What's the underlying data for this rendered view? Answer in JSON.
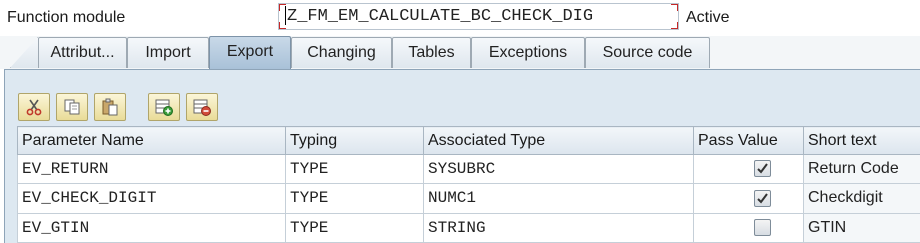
{
  "header": {
    "label": "Function module",
    "value": "Z_FM_EM_CALCULATE_BC_CHECK_DIG",
    "status": "Active"
  },
  "tabs": [
    {
      "label": "Attribut...",
      "active": false
    },
    {
      "label": "Import",
      "active": false
    },
    {
      "label": "Export",
      "active": true
    },
    {
      "label": "Changing",
      "active": false
    },
    {
      "label": "Tables",
      "active": false
    },
    {
      "label": "Exceptions",
      "active": false
    },
    {
      "label": "Source code",
      "active": false
    }
  ],
  "toolbar": {
    "icons": [
      "cut-icon",
      "copy-icon",
      "paste-icon",
      "insert-row-icon",
      "delete-row-icon"
    ]
  },
  "table": {
    "columns": [
      "Parameter Name",
      "Typing",
      "Associated Type",
      "Pass Value",
      "Short text"
    ],
    "rows": [
      {
        "name": "EV_RETURN",
        "typing": "TYPE",
        "assoc": "SYSUBRC",
        "pass_value": true,
        "short": "Return Code"
      },
      {
        "name": "EV_CHECK_DIGIT",
        "typing": "TYPE",
        "assoc": "NUMC1",
        "pass_value": true,
        "short": "Checkdigit"
      },
      {
        "name": "EV_GTIN",
        "typing": "TYPE",
        "assoc": "STRING",
        "pass_value": false,
        "short": "GTIN"
      }
    ]
  },
  "colors": {
    "panel_bg": "#dde8f1",
    "active_tab": "#b7cce0",
    "focus_border": "#c62828",
    "toolbar_button": "#efe3a8"
  }
}
